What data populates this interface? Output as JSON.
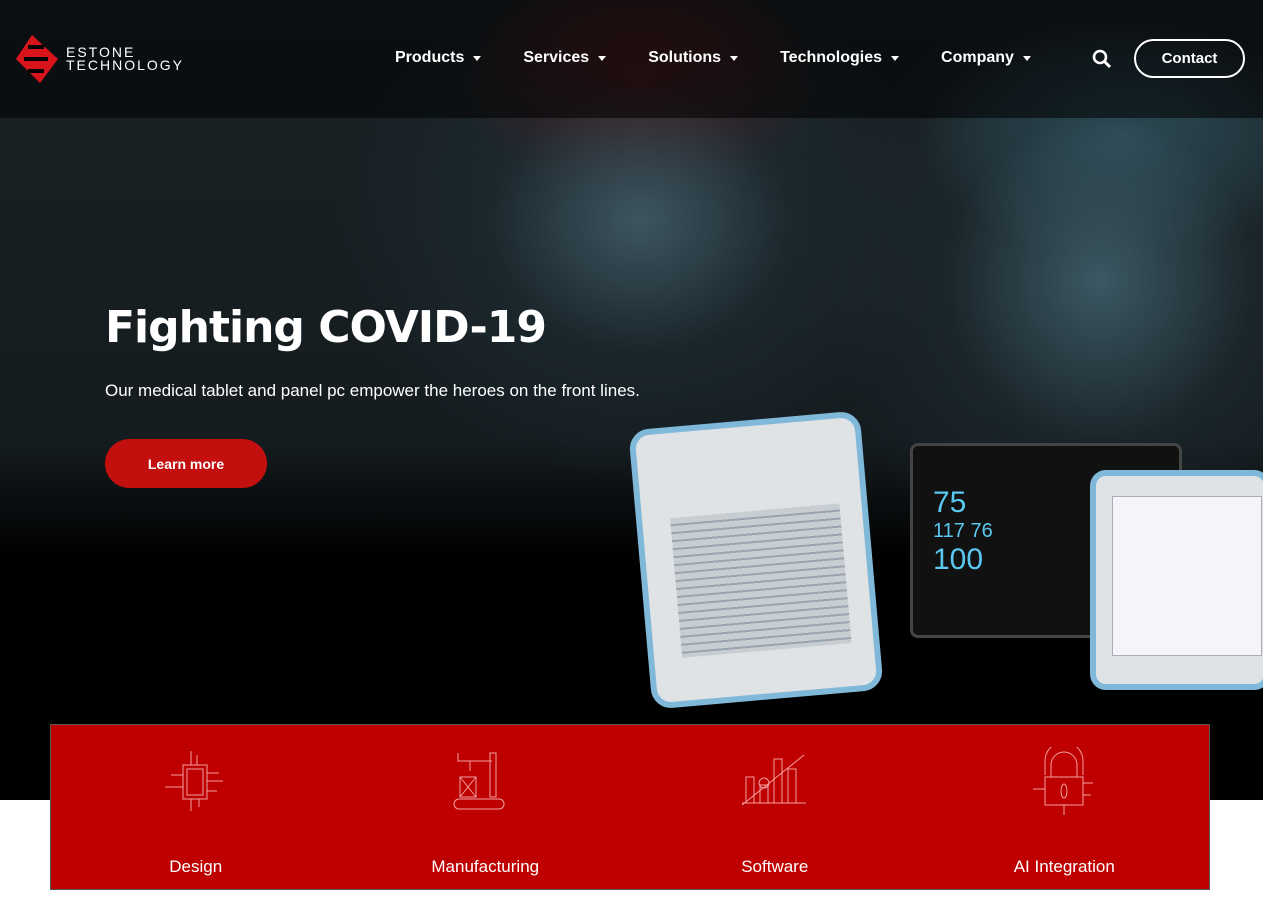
{
  "brand": {
    "line1": "ESTONE",
    "line2": "TECHNOLOGY",
    "accent": "#be0000"
  },
  "nav": {
    "items": [
      {
        "label": "Products"
      },
      {
        "label": "Services"
      },
      {
        "label": "Solutions"
      },
      {
        "label": "Technologies"
      },
      {
        "label": "Company"
      }
    ],
    "contact": "Contact",
    "search_icon": "search-icon"
  },
  "hero": {
    "title": "Fighting COVID-19",
    "subtitle": "Our medical tablet and panel pc empower the heroes on the front lines.",
    "cta": "Learn more",
    "monitor_values": [
      "75",
      "117",
      "76",
      "100"
    ]
  },
  "features": [
    {
      "label": "Design",
      "icon": "chip-icon"
    },
    {
      "label": "Manufacturing",
      "icon": "factory-icon"
    },
    {
      "label": "Software",
      "icon": "chart-icon"
    },
    {
      "label": "AI Integration",
      "icon": "lock-icon"
    }
  ]
}
